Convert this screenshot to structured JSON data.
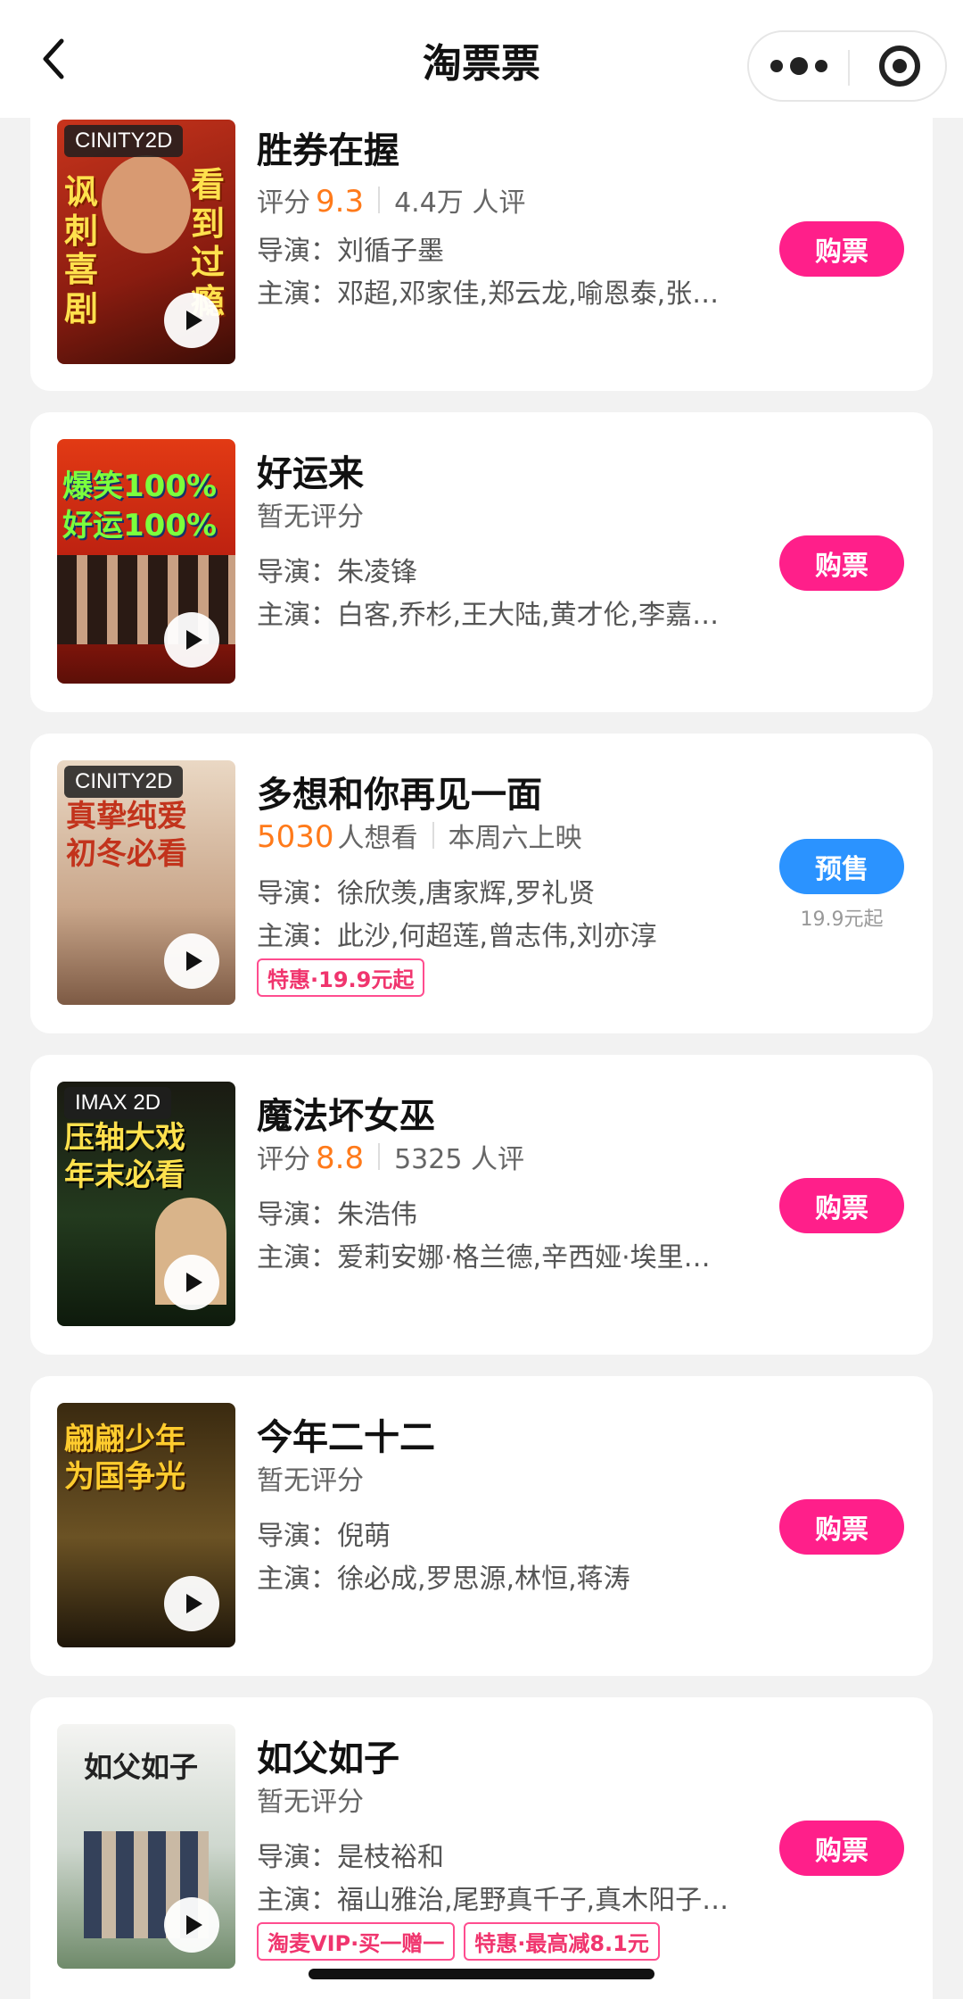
{
  "nav": {
    "title": "淘票票"
  },
  "movies": [
    {
      "title": "胜券在握",
      "poster_tag": "CINITY2D",
      "poster_text": "讽刺喜剧 看到过瘾",
      "rating_label": "评分",
      "score": "9.3",
      "reviews": "4.4万 人评",
      "director": "导演：刘循子墨",
      "cast": "主演：邓超,邓家佳,郑云龙,喻恩泰,张…",
      "button": "购票"
    },
    {
      "title": "好运来",
      "poster_tag": "",
      "poster_text": "爆笑100% 好运100%",
      "rating_label": "暂无评分",
      "director": "导演：朱凌锋",
      "cast": "主演：白客,乔杉,王大陆,黄才伦,李嘉…",
      "button": "购票"
    },
    {
      "title": "多想和你再见一面",
      "poster_tag": "CINITY2D",
      "poster_text": "真挚纯爱 初冬必看",
      "want_count": "5030",
      "want_label": "人想看",
      "release": "本周六上映",
      "director": "导演：徐欣羡,唐家辉,罗礼贤",
      "cast": "主演：此沙,何超莲,曾志伟,刘亦淳",
      "promos": [
        "特惠·19.9元起"
      ],
      "button": "预售",
      "price_hint": "19.9元起"
    },
    {
      "title": "魔法坏女巫",
      "poster_tag": "IMAX 2D",
      "poster_text": "压轴大戏 年末必看",
      "rating_label": "评分",
      "score": "8.8",
      "reviews": "5325 人评",
      "director": "导演：朱浩伟",
      "cast": "主演：爱莉安娜·格兰德,辛西娅·埃里…",
      "button": "购票"
    },
    {
      "title": "今年二十二",
      "poster_tag": "",
      "poster_text": "翩翩少年 为国争光",
      "rating_label": "暂无评分",
      "director": "导演：倪萌",
      "cast": "主演：徐必成,罗思源,林恒,蒋涛",
      "button": "购票"
    },
    {
      "title": "如父如子",
      "poster_tag": "",
      "poster_text": "如父如子",
      "rating_label": "暂无评分",
      "director": "导演：是枝裕和",
      "cast": "主演：福山雅治,尾野真千子,真木阳子…",
      "promos": [
        "淘麦VIP·买一赠一",
        "特惠·最高减8.1元"
      ],
      "button": "购票"
    }
  ],
  "colors": {
    "buy": "#ff1f8a",
    "presale": "#2b93ff",
    "score": "#ff7a1a",
    "promo": "#f0356e"
  }
}
